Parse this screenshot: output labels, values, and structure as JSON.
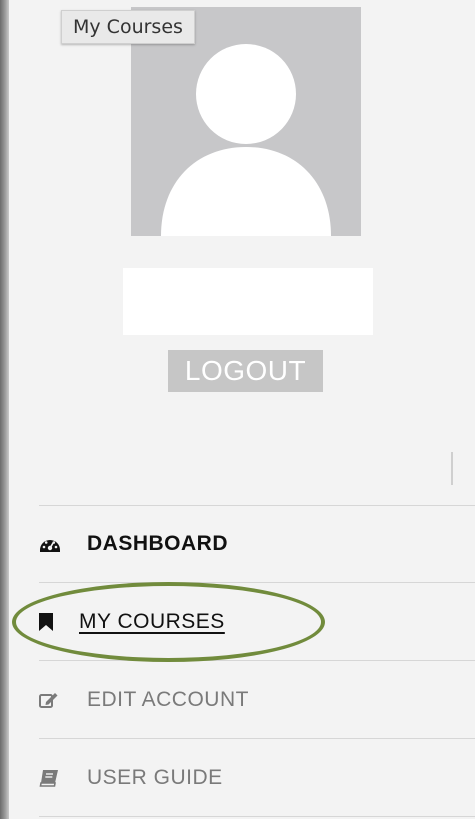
{
  "tooltip": {
    "text": "My Courses"
  },
  "user": {
    "avatar_icon": "user-silhouette-icon",
    "name": ""
  },
  "logout": {
    "label": "LOGOUT"
  },
  "menu": {
    "items": [
      {
        "label": "DASHBOARD",
        "icon": "dashboard-icon",
        "active": true
      },
      {
        "label": "MY COURSES",
        "icon": "bookmark-icon",
        "hovered": true
      },
      {
        "label": "EDIT ACCOUNT",
        "icon": "edit-icon"
      },
      {
        "label": "USER GUIDE",
        "icon": "book-icon"
      }
    ]
  },
  "colors": {
    "background": "#f3f3f3",
    "avatar_bg": "#c7c7c9",
    "logout_bg": "#c6c6c6",
    "highlight": "#718b3c",
    "muted_text": "#7a7a7a"
  }
}
